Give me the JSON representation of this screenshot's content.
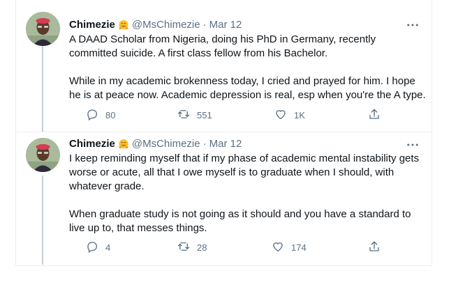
{
  "tweets": [
    {
      "display_name": "Chimezie",
      "handle": "@MsChimezie",
      "date": "Mar 12",
      "separator": "·",
      "text": "A DAAD Scholar from Nigeria,  doing his PhD in Germany, recently committed suicide.  A first class fellow from his Bachelor.\n\nWhile in my academic brokenness today,  I cried and prayed for him. I hope he is at peace now. Academic depression is real, esp when you're the A type.",
      "replies": "80",
      "retweets": "551",
      "likes": "1K"
    },
    {
      "display_name": "Chimezie",
      "handle": "@MsChimezie",
      "date": "Mar 12",
      "separator": "·",
      "text": "I keep reminding myself that if my phase of academic mental instability gets worse or acute,  all that I owe myself is to graduate when I should, with whatever grade.\n\nWhen graduate study is not going as it should and you have a standard to live up to,  that messes things.",
      "replies": "4",
      "retweets": "28",
      "likes": "174"
    }
  ],
  "icons": {
    "name_emoji": "hugging-face-icon",
    "more": "more-dots-icon",
    "reply": "reply-icon",
    "retweet": "retweet-icon",
    "like": "heart-icon",
    "share": "share-icon"
  },
  "colors": {
    "text": "#0f1419",
    "secondary": "#5b7083",
    "divider": "#ebeef0",
    "thread_line": "#c4cfd6"
  }
}
